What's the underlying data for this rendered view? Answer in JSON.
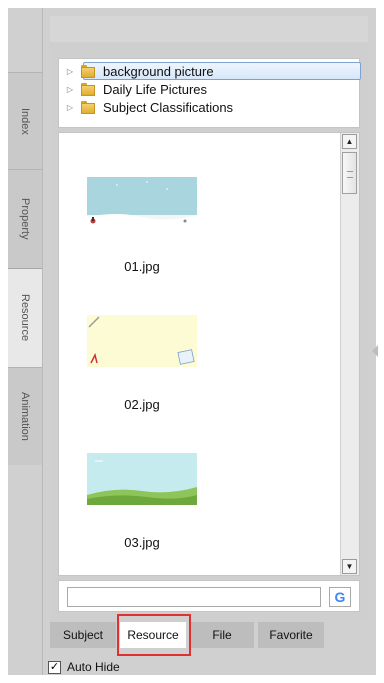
{
  "side_tabs": [
    {
      "label": "Index",
      "active": false
    },
    {
      "label": "Property",
      "active": false
    },
    {
      "label": "Resource",
      "active": true
    },
    {
      "label": "Animation",
      "active": false
    }
  ],
  "tree": [
    {
      "label": "background picture",
      "selected": true
    },
    {
      "label": "Daily Life Pictures",
      "selected": false
    },
    {
      "label": "Subject Classifications",
      "selected": false
    }
  ],
  "files": [
    {
      "name": "01.jpg"
    },
    {
      "name": "02.jpg"
    },
    {
      "name": "03.jpg"
    }
  ],
  "search": {
    "value": "",
    "button_glyph": "G"
  },
  "bottom_tabs": [
    {
      "label": "Subject",
      "active": false
    },
    {
      "label": "Resource",
      "active": true
    },
    {
      "label": "File",
      "active": false
    },
    {
      "label": "Favorite",
      "active": false
    }
  ],
  "auto_hide": {
    "label": "Auto Hide",
    "checked": true
  },
  "colors": {
    "highlight_box": "#e03030",
    "google_blue": "#4285f4"
  }
}
